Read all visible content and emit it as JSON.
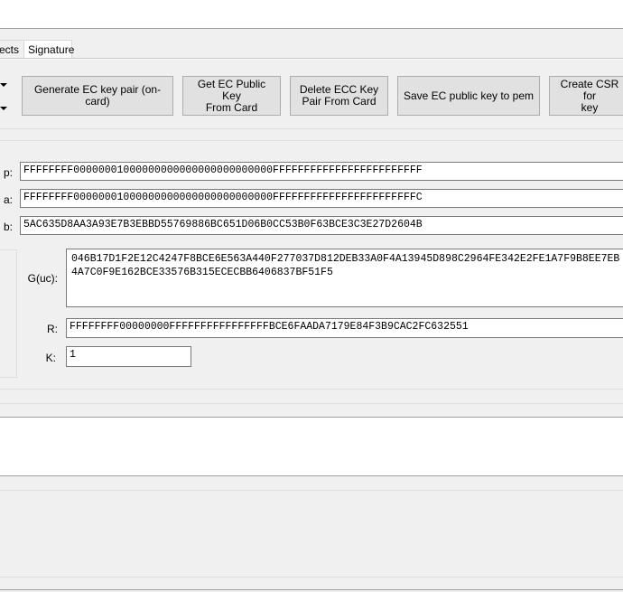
{
  "tabs": [
    {
      "label": "ects"
    },
    {
      "label": "Signature"
    }
  ],
  "buttons": {
    "generate": "Generate EC key pair (on-card)",
    "get_public": "Get EC Public Key\nFrom Card",
    "delete_pair": "Delete ECC Key\nPair From Card",
    "save_pem": "Save EC public key to pem",
    "create_csr": "Create CSR for\nkey"
  },
  "curve": {
    "p_label": "p:",
    "p_value": "FFFFFFFF00000001000000000000000000000000FFFFFFFFFFFFFFFFFFFFFFFF",
    "a_label": "a:",
    "a_value": "FFFFFFFF00000001000000000000000000000000FFFFFFFFFFFFFFFFFFFFFFFC",
    "b_label": "b:",
    "b_value": "5AC635D8AA3A93E7B3EBBD55769886BC651D06B0CC53B0F63BCE3C3E27D2604B",
    "g_label": "G(uc):",
    "g_value": "046B17D1F2E12C4247F8BCE6E563A440F277037D812DEB33A0F4A13945D898C2964FE342E2FE1A7F9B8EE7EB4A7C0F9E162BCE33576B315ECECBB6406837BF51F5",
    "r_label": "R:",
    "r_value": "FFFFFFFF00000000FFFFFFFFFFFFFFFFBCE6FAADA7179E84F3B9CAC2FC632551",
    "k_label": "K:",
    "k_value": "1"
  }
}
